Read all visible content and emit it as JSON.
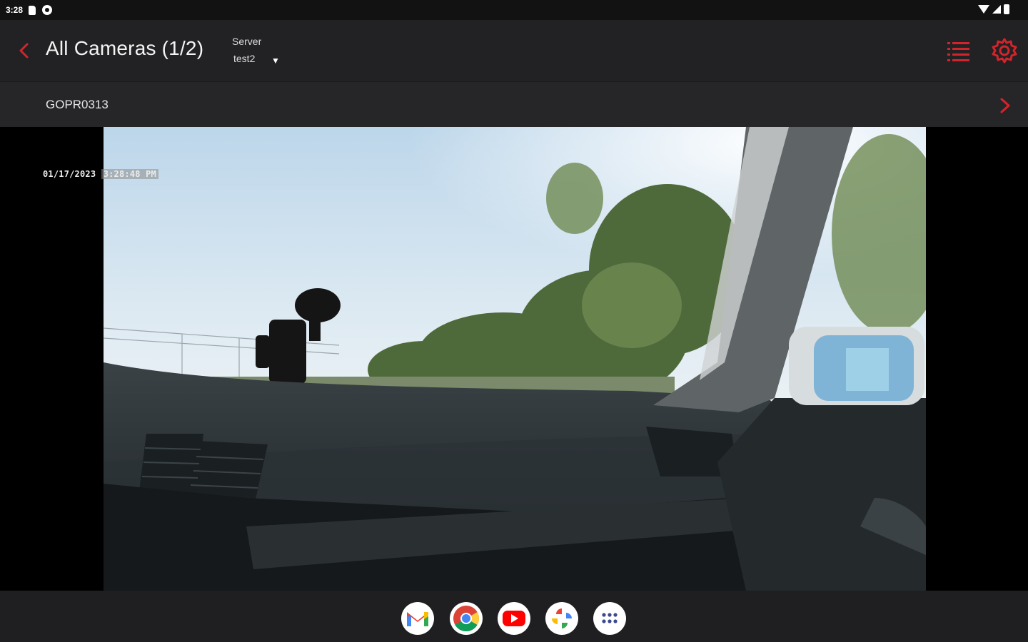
{
  "status_bar": {
    "time": "3:28",
    "icons": [
      "sd-card-icon",
      "settings-notification-icon",
      "wifi-icon",
      "signal-icon",
      "battery-icon"
    ]
  },
  "header": {
    "back_icon": "chevron-left-icon",
    "title": "All Cameras (1/2)",
    "server_label": "Server",
    "server_value": "test2",
    "list_icon": "list-icon",
    "settings_icon": "gear-icon"
  },
  "clip": {
    "name": "GOPR0313",
    "next_icon": "chevron-right-icon"
  },
  "video": {
    "timestamp_date": "01/17/2023",
    "timestamp_time": "3:28:48 PM"
  },
  "dock": {
    "apps": [
      "gmail-icon",
      "chrome-icon",
      "youtube-icon",
      "photos-icon",
      "app-drawer-icon"
    ]
  },
  "colors": {
    "accent": "#d2252b",
    "background": "#1f1f21"
  }
}
